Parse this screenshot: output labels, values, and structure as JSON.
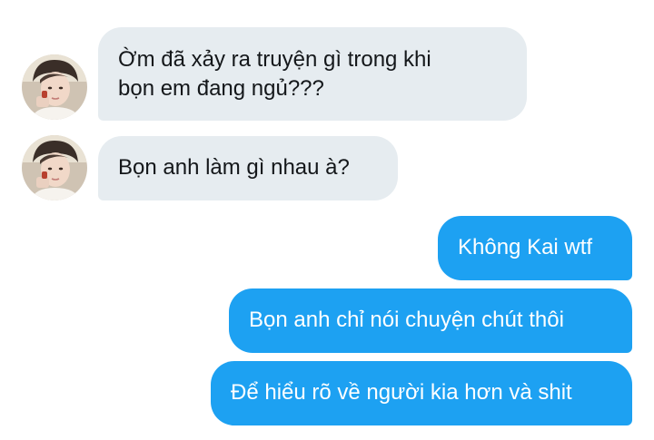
{
  "conversation": {
    "messages": [
      {
        "sender": "other",
        "avatar": "profile-photo-avatar",
        "lines": [
          "Ờm đã xảy ra truyện gì trong khi",
          "bọn em đang ngủ???"
        ]
      },
      {
        "sender": "other",
        "avatar": "profile-photo-avatar",
        "lines": [
          "Bọn anh làm gì nhau à?"
        ]
      },
      {
        "sender": "self",
        "lines": [
          "Không Kai wtf"
        ]
      },
      {
        "sender": "self",
        "lines": [
          "Bọn anh chỉ nói chuyện chút thôi"
        ]
      },
      {
        "sender": "self",
        "lines": [
          "Để hiểu rõ về người kia hơn và shit"
        ]
      }
    ]
  },
  "colors": {
    "incoming_bubble": "#e6ecf0",
    "incoming_text": "#14171a",
    "outgoing_bubble": "#1da1f2",
    "outgoing_text": "#ffffff",
    "background": "#ffffff"
  }
}
